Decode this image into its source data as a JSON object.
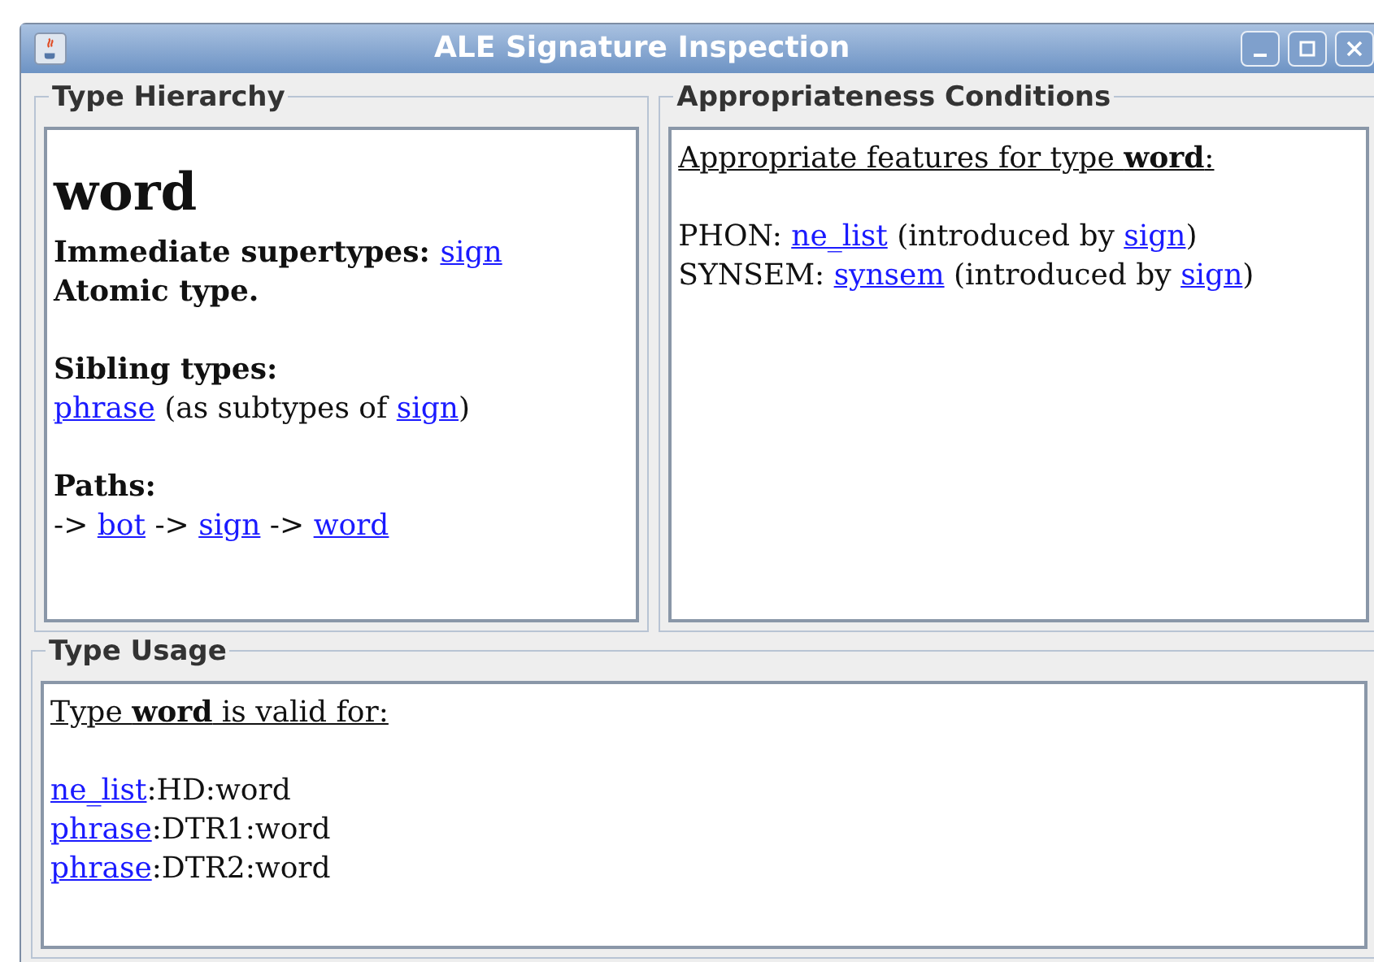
{
  "window": {
    "title": "ALE Signature Inspection"
  },
  "type_hierarchy": {
    "title": "Type Hierarchy",
    "type_name": "word",
    "blocks": [
      {
        "lines": [
          [
            {
              "kind": "bold",
              "text": "Immediate supertypes:"
            },
            {
              "kind": "link",
              "text": "sign"
            }
          ],
          [
            {
              "kind": "bold",
              "text": "Atomic type."
            }
          ]
        ]
      },
      {
        "lines": [
          [
            {
              "kind": "bold",
              "text": "Sibling types:"
            }
          ],
          [
            {
              "kind": "link",
              "text": "phrase"
            },
            {
              "kind": "text",
              "text": " (as subtypes of "
            },
            {
              "kind": "link",
              "text": "sign"
            },
            {
              "kind": "text",
              "text": ")"
            }
          ]
        ]
      },
      {
        "lines": [
          [
            {
              "kind": "bold",
              "text": "Paths:"
            }
          ],
          [
            {
              "kind": "text",
              "text": "-> "
            },
            {
              "kind": "link",
              "text": "bot"
            },
            {
              "kind": "text",
              "text": " -> "
            },
            {
              "kind": "link",
              "text": "sign"
            },
            {
              "kind": "text",
              "text": " -> "
            },
            {
              "kind": "link",
              "text": "word"
            }
          ]
        ]
      }
    ]
  },
  "appropriateness": {
    "title": "Appropriateness Conditions",
    "heading": "Appropriate features for type **word**:",
    "lines": [
      [
        {
          "kind": "text",
          "text": "PHON: "
        },
        {
          "kind": "link",
          "text": "ne_list"
        },
        {
          "kind": "text",
          "text": " (introduced by "
        },
        {
          "kind": "link",
          "text": "sign"
        },
        {
          "kind": "text",
          "text": ")"
        }
      ],
      [
        {
          "kind": "text",
          "text": "SYNSEM: "
        },
        {
          "kind": "link",
          "text": "synsem"
        },
        {
          "kind": "text",
          "text": " (introduced by "
        },
        {
          "kind": "link",
          "text": "sign"
        },
        {
          "kind": "text",
          "text": ")"
        }
      ]
    ]
  },
  "type_usage": {
    "title": "Type Usage",
    "heading": "Type **word** is valid for:",
    "lines": [
      [
        {
          "kind": "link",
          "text": "ne_list"
        },
        {
          "kind": "text",
          "text": ":HD:word"
        }
      ],
      [
        {
          "kind": "link",
          "text": "phrase"
        },
        {
          "kind": "text",
          "text": ":DTR1:word"
        }
      ],
      [
        {
          "kind": "link",
          "text": "phrase"
        },
        {
          "kind": "text",
          "text": ":DTR2:word"
        }
      ]
    ]
  }
}
